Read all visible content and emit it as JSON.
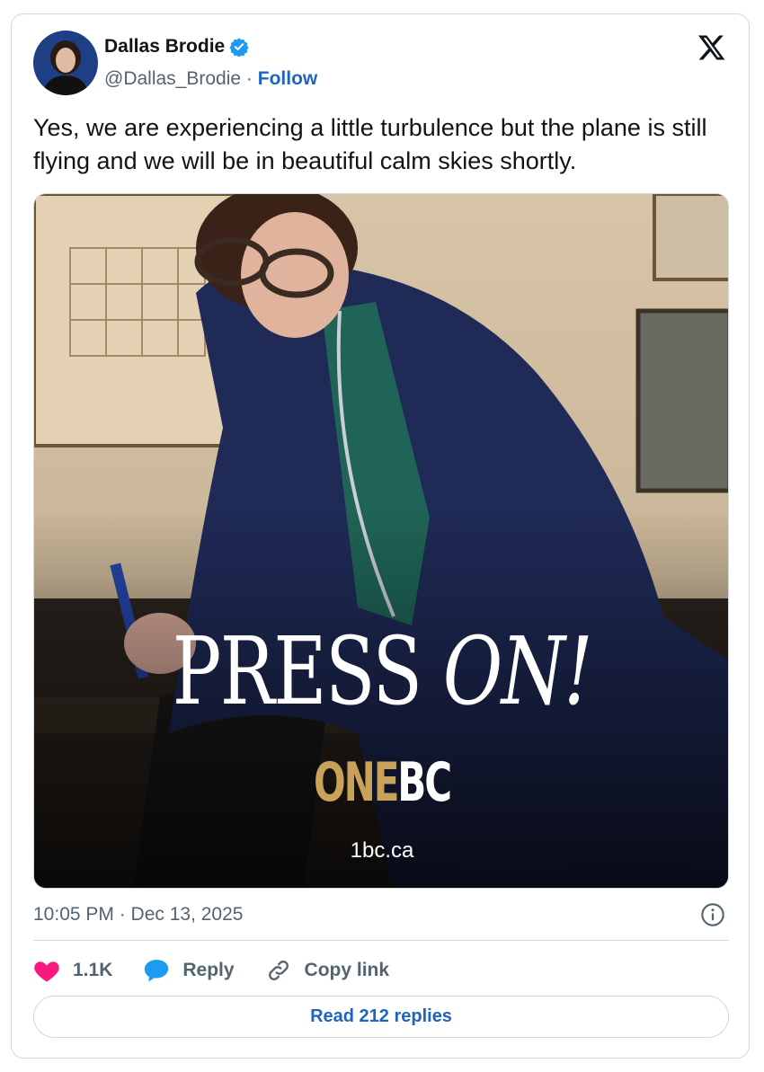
{
  "author": {
    "name": "Dallas Brodie",
    "handle": "@Dallas_Brodie",
    "separator": "·",
    "follow_label": "Follow"
  },
  "tweet": {
    "text": "Yes, we are experiencing a little turbulence but the plane is still flying and we will be in beautiful calm skies shortly.",
    "timestamp": "10:05 PM · Dec 13, 2025"
  },
  "media": {
    "headline_main": "PRESS ",
    "headline_emphasis": "ON!",
    "brand_part1": "ONE",
    "brand_part2": "BC",
    "website": "1bc.ca"
  },
  "actions": {
    "like_count": "1.1K",
    "reply_label": "Reply",
    "copy_label": "Copy link"
  },
  "read_replies_label": "Read 212 replies",
  "colors": {
    "accent": "#1d65c1",
    "like": "#f91880",
    "reply_icon": "#1d9bf0",
    "brand_gold": "#c9a25a"
  },
  "icons": [
    "verified-badge-icon",
    "x-logo-icon",
    "info-icon",
    "heart-icon",
    "reply-bubble-icon",
    "link-icon"
  ]
}
